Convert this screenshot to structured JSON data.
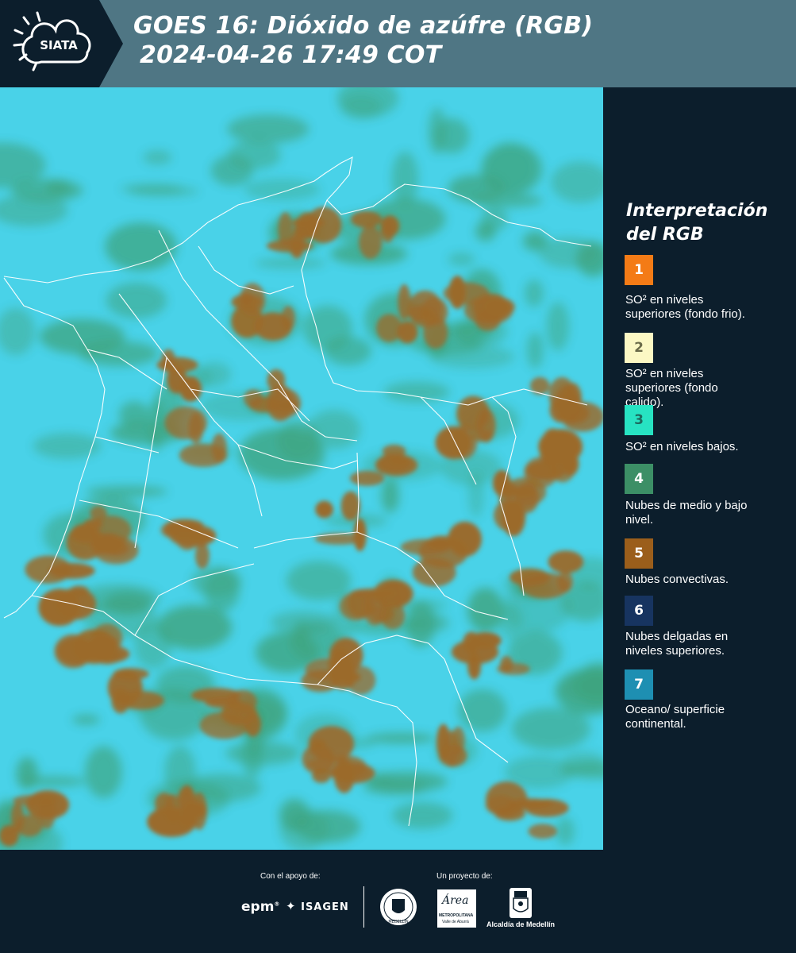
{
  "header": {
    "logo_text": "SIATA",
    "title_line1": "GOES 16: Dióxido de azúfre (RGB)",
    "title_line2": "2024-04-26 17:49 COT"
  },
  "legend": {
    "title_line1": "Interpretación",
    "title_line2": "del RGB",
    "items": [
      {
        "num": "1",
        "color": "#f47b16",
        "text_color": "#ffffff",
        "lines": [
          "SO² en niveles",
          "superiores (fondo frio)."
        ]
      },
      {
        "num": "2",
        "color": "#fcf8c4",
        "text_color": "#6b6b4a",
        "lines": [
          "SO² en niveles",
          "superiores (fondo",
          "calido)."
        ]
      },
      {
        "num": "3",
        "color": "#27e3c2",
        "text_color": "#1d6a5e",
        "lines": [
          "SO² en niveles bajos."
        ]
      },
      {
        "num": "4",
        "color": "#3c8f66",
        "text_color": "#ffffff",
        "lines": [
          "Nubes de medio y bajo",
          "nivel."
        ]
      },
      {
        "num": "5",
        "color": "#9b5e1b",
        "text_color": "#ffffff",
        "lines": [
          "Nubes convectivas."
        ]
      },
      {
        "num": "6",
        "color": "#173460",
        "text_color": "#ffffff",
        "lines": [
          "Nubes delgadas en",
          "niveles superiores."
        ]
      },
      {
        "num": "7",
        "color": "#1e8fb2",
        "text_color": "#ffffff",
        "lines": [
          "Oceano/ superficie",
          "continental."
        ]
      }
    ]
  },
  "footer": {
    "support_label": "Con el apoyo de:",
    "project_label": "Un proyecto de:",
    "epm": "epm",
    "isagen": "ISAGEN",
    "metropolitana": "METROPOLITANA",
    "valle": "Valle de Aburrá",
    "area": "Área",
    "alcaldia": "Alcaldía de Medellín",
    "medellin": "MEDELLÍN"
  },
  "colors": {
    "header_bg": "#4f7684",
    "page_bg": "#0c1e2c",
    "map_ocean": "#49d2e8",
    "map_cloud": "#9b6a2a",
    "map_green": "#3d9c6c"
  }
}
